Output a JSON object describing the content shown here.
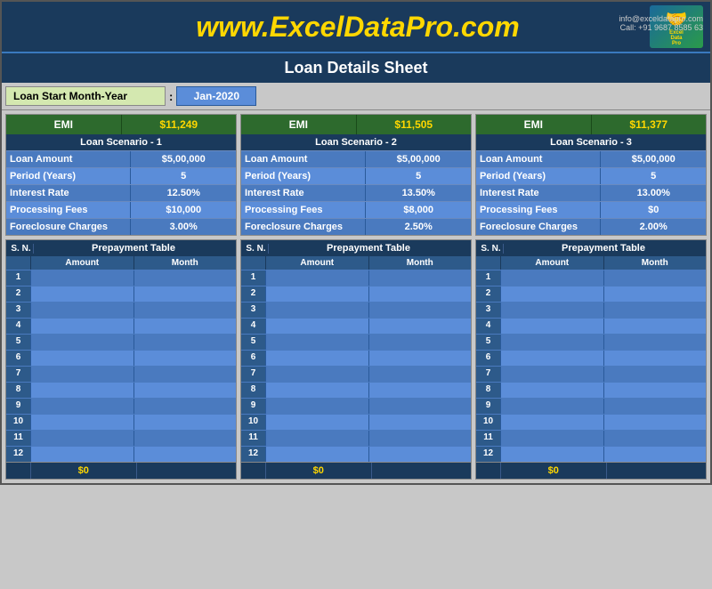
{
  "header": {
    "url": "www.ExcelDataPro.com",
    "sheet_title": "Loan Details Sheet",
    "contact_line1": "info@exceldatapro.com",
    "contact_line2": "Call: +91 9687 8585 63"
  },
  "loan_start": {
    "label": "Loan Start Month-Year",
    "colon": ":",
    "value": "Jan-2020"
  },
  "scenarios": [
    {
      "emi_label": "EMI",
      "emi_value": "$11,249",
      "title": "Loan Scenario - 1",
      "rows": [
        {
          "label": "Loan Amount",
          "value": "$5,00,000"
        },
        {
          "label": "Period (Years)",
          "value": "5"
        },
        {
          "label": "Interest Rate",
          "value": "12.50%"
        },
        {
          "label": "Processing Fees",
          "value": "$10,000"
        },
        {
          "label": "Foreclosure Charges",
          "value": "3.00%"
        }
      ]
    },
    {
      "emi_label": "EMI",
      "emi_value": "$11,505",
      "title": "Loan Scenario - 2",
      "rows": [
        {
          "label": "Loan Amount",
          "value": "$5,00,000"
        },
        {
          "label": "Period (Years)",
          "value": "5"
        },
        {
          "label": "Interest Rate",
          "value": "13.50%"
        },
        {
          "label": "Processing Fees",
          "value": "$8,000"
        },
        {
          "label": "Foreclosure Charges",
          "value": "2.50%"
        }
      ]
    },
    {
      "emi_label": "EMI",
      "emi_value": "$11,377",
      "title": "Loan Scenario - 3",
      "rows": [
        {
          "label": "Loan Amount",
          "value": "$5,00,000"
        },
        {
          "label": "Period (Years)",
          "value": "5"
        },
        {
          "label": "Interest Rate",
          "value": "13.00%"
        },
        {
          "label": "Processing Fees",
          "value": "$0"
        },
        {
          "label": "Foreclosure Charges",
          "value": "2.00%"
        }
      ]
    }
  ],
  "prepayment": {
    "table_title": "Prepayment Table",
    "sn_label": "S. N.",
    "amount_label": "Amount",
    "month_label": "Month",
    "rows": [
      1,
      2,
      3,
      4,
      5,
      6,
      7,
      8,
      9,
      10,
      11,
      12
    ],
    "totals": [
      "$0",
      "$0",
      "$0"
    ]
  }
}
